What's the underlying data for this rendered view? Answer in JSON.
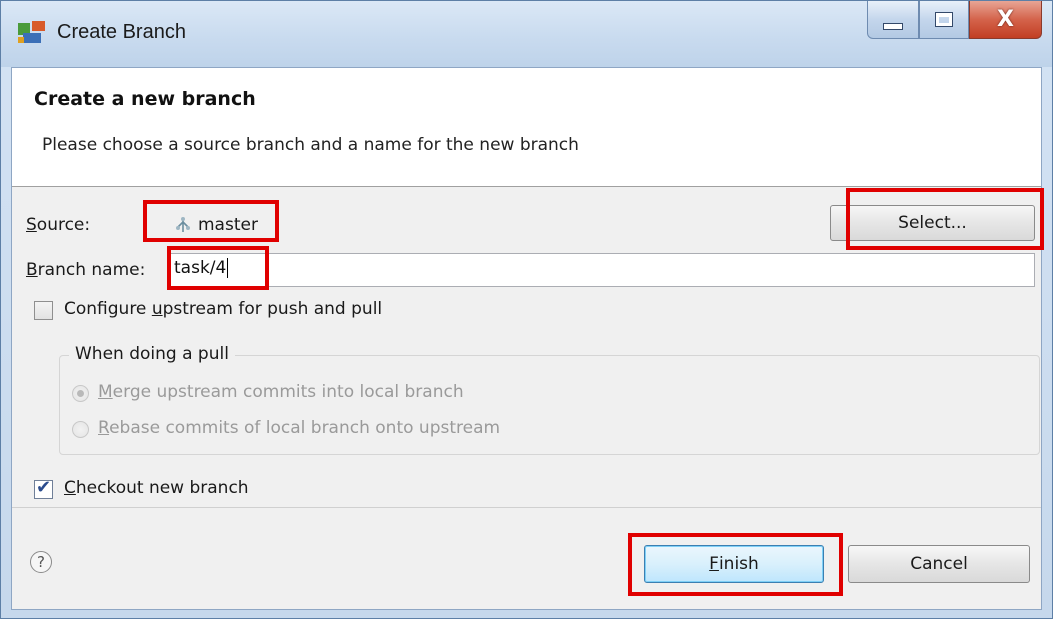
{
  "window": {
    "title": "Create Branch",
    "controls": {
      "minimize": "minimize-button",
      "maximize": "maximize-button",
      "close": "X"
    }
  },
  "banner": {
    "title": "Create a new branch",
    "description": "Please choose a source branch and a name for the new branch"
  },
  "source": {
    "label_mnemonic": "S",
    "label_rest": "ource:",
    "value": "master",
    "select_button": "Select..."
  },
  "branch_name": {
    "label_mnemonic": "B",
    "label_rest": "ranch name:",
    "value": "task/4"
  },
  "configure_upstream": {
    "label_before": "Configure ",
    "label_mnemonic": "u",
    "label_after": "pstream for push and pull",
    "checked": false
  },
  "pull_group": {
    "title": "When doing a pull",
    "options": [
      {
        "mnemonic": "M",
        "rest": "erge upstream commits into local branch",
        "selected": true,
        "enabled": false
      },
      {
        "mnemonic": "R",
        "rest": "ebase commits of local branch onto upstream",
        "selected": false,
        "enabled": false
      }
    ]
  },
  "checkout": {
    "label_mnemonic": "C",
    "label_rest": "heckout new branch",
    "checked": true
  },
  "footer": {
    "help_glyph": "?",
    "finish_mnemonic": "F",
    "finish_rest": "inish",
    "cancel": "Cancel"
  },
  "colors": {
    "highlight": "#e00000",
    "finish_border": "#3c7fb1",
    "title_bar": "#c9dbef"
  }
}
